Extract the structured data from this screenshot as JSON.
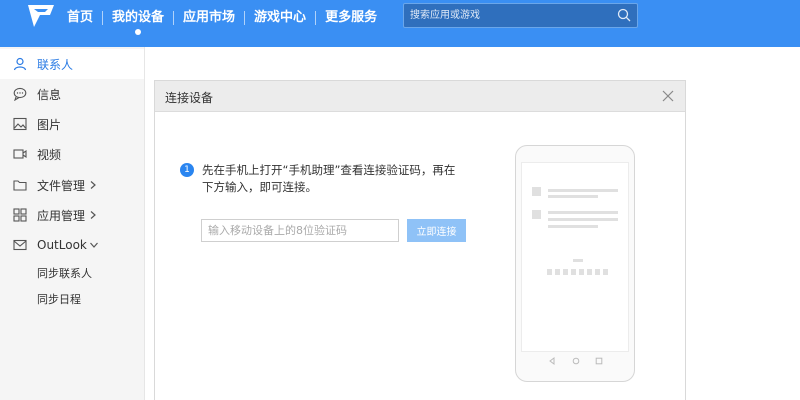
{
  "header": {
    "nav": [
      {
        "label": "首页",
        "active": false
      },
      {
        "label": "我的设备",
        "active": true
      },
      {
        "label": "应用市场",
        "active": false
      },
      {
        "label": "游戏中心",
        "active": false
      },
      {
        "label": "更多服务",
        "active": false
      }
    ],
    "search": {
      "placeholder": "搜索应用或游戏",
      "icon": "search-icon"
    }
  },
  "sidebar": {
    "items": [
      {
        "label": "联系人",
        "icon": "contact-icon",
        "active": true
      },
      {
        "label": "信息",
        "icon": "message-icon"
      },
      {
        "label": "图片",
        "icon": "image-icon"
      },
      {
        "label": "视频",
        "icon": "video-icon"
      },
      {
        "label": "文件管理",
        "icon": "folder-icon",
        "has_arrow": "right"
      },
      {
        "label": "应用管理",
        "icon": "apps-icon",
        "has_arrow": "right"
      },
      {
        "label": "OutLook",
        "icon": "mail-icon",
        "has_arrow": "down"
      }
    ],
    "subitems": [
      {
        "label": "同步联系人"
      },
      {
        "label": "同步日程"
      }
    ]
  },
  "dialog": {
    "title": "连接设备",
    "step_number": "1",
    "instruction_line1": "先在手机上打开“手机助理”查看连接验证码，再在",
    "instruction_line2": "下方输入，即可连接。",
    "code_input_placeholder": "输入移动设备上的8位验证码",
    "connect_button": "立即连接"
  },
  "colors": {
    "header_bg": "#3a8ff3",
    "accent": "#2a7be4",
    "button_bg": "#8fc2f7"
  }
}
